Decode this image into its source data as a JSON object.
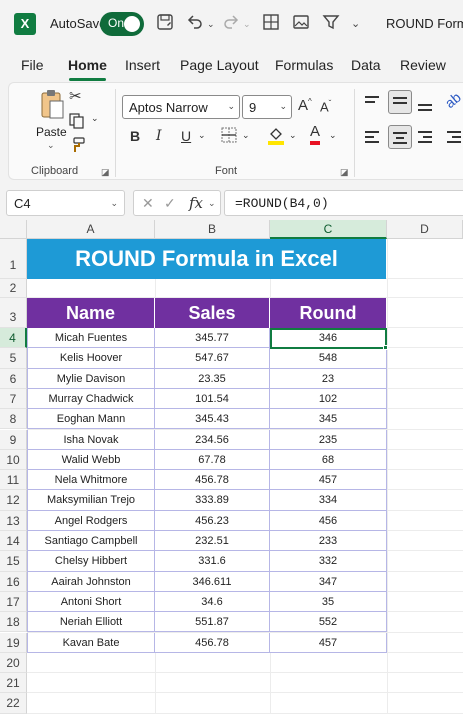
{
  "titlebar": {
    "autosave_label": "AutoSave",
    "toggle_text": "On",
    "document_title": "ROUND Formu",
    "icons": [
      "excel-logo",
      "save-icon",
      "undo-icon",
      "redo-icon",
      "borders-icon",
      "picture-icon",
      "filter-icon",
      "chevron-down-icon"
    ]
  },
  "menu": {
    "items": [
      "File",
      "Home",
      "Insert",
      "Page Layout",
      "Formulas",
      "Data",
      "Review"
    ],
    "active": "Home"
  },
  "ribbon": {
    "clipboard": {
      "paste_label": "Paste",
      "group_label": "Clipboard"
    },
    "font": {
      "font_name": "Aptos Narrow",
      "font_size": "9",
      "group_label": "Font",
      "bold": "B",
      "italic": "I",
      "underline": "U",
      "grow": "A",
      "shrink": "A",
      "font_color": "A"
    }
  },
  "formula_bar": {
    "name_box": "C4",
    "fx": "fx",
    "formula": "=ROUND(B4,0)"
  },
  "sheet": {
    "columns": [
      "A",
      "B",
      "C",
      "D"
    ],
    "rows": [
      "1",
      "2",
      "3",
      "4",
      "5",
      "6",
      "7",
      "8",
      "9",
      "10",
      "11",
      "12",
      "13",
      "14",
      "15",
      "16",
      "17",
      "18",
      "19",
      "20",
      "21",
      "22"
    ],
    "selected_column": "C",
    "selected_row": "4",
    "title": "ROUND Formula in Excel",
    "headers": [
      "Name",
      "Sales",
      "Round"
    ],
    "data": [
      [
        "Micah Fuentes",
        "345.77",
        "346"
      ],
      [
        "Kelis Hoover",
        "547.67",
        "548"
      ],
      [
        "Mylie Davison",
        "23.35",
        "23"
      ],
      [
        "Murray Chadwick",
        "101.54",
        "102"
      ],
      [
        "Eoghan Mann",
        "345.43",
        "345"
      ],
      [
        "Isha Novak",
        "234.56",
        "235"
      ],
      [
        "Walid Webb",
        "67.78",
        "68"
      ],
      [
        "Nela Whitmore",
        "456.78",
        "457"
      ],
      [
        "Maksymilian Trejo",
        "333.89",
        "334"
      ],
      [
        "Angel Rodgers",
        "456.23",
        "456"
      ],
      [
        "Santiago Campbell",
        "232.51",
        "233"
      ],
      [
        "Chelsy Hibbert",
        "331.6",
        "332"
      ],
      [
        "Aairah Johnston",
        "346.611",
        "347"
      ],
      [
        "Antoni Short",
        "34.6",
        "35"
      ],
      [
        "Neriah Elliott",
        "551.87",
        "552"
      ],
      [
        "Kavan Bate",
        "456.78",
        "457"
      ]
    ]
  },
  "colors": {
    "title_banner": "#1e9ad6",
    "header_fill": "#7030a0",
    "table_border": "#b6b6e6",
    "accent": "#107c41"
  }
}
